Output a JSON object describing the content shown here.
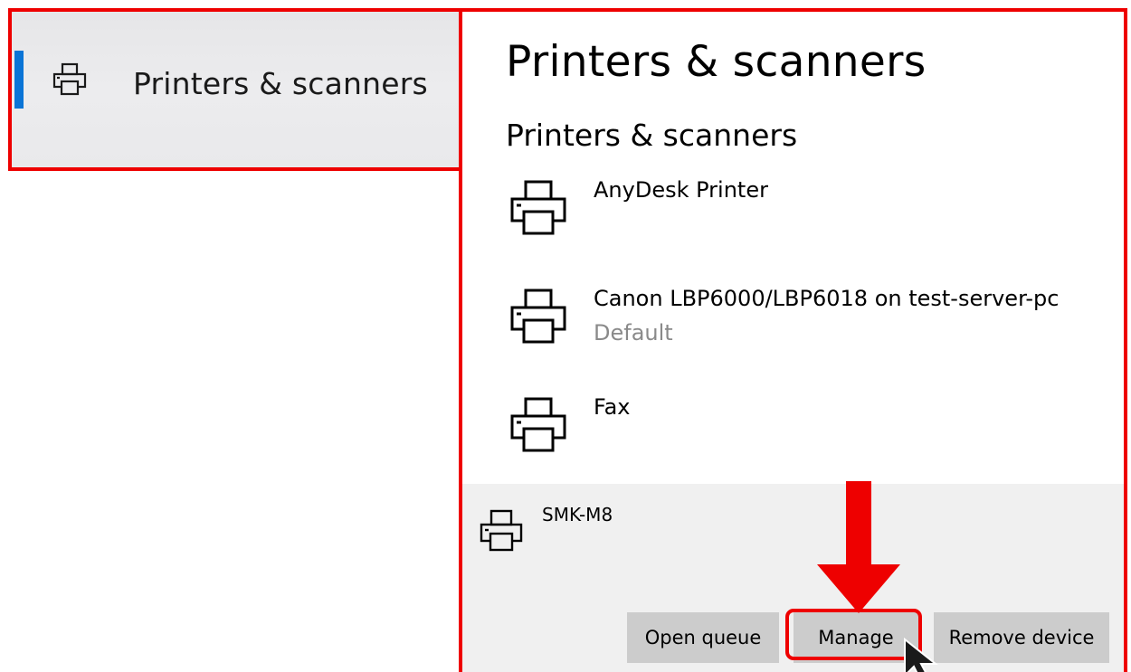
{
  "nav": {
    "label": "Printers & scanners",
    "icon": "printer-icon",
    "accent_color": "#0a74d6"
  },
  "page": {
    "title": "Printers & scanners",
    "section_title": "Printers & scanners"
  },
  "printers": [
    {
      "name": "AnyDesk Printer",
      "status": "",
      "icon": "printer-icon"
    },
    {
      "name": "Canon LBP6000/LBP6018 on test-server-pc",
      "status": "Default",
      "icon": "printer-icon"
    },
    {
      "name": "Fax",
      "status": "",
      "icon": "printer-icon"
    }
  ],
  "selected_printer": {
    "name": "SMK-M8",
    "icon": "printer-icon",
    "buttons": {
      "open_queue": "Open queue",
      "manage": "Manage",
      "remove_device": "Remove device"
    }
  },
  "annotations": {
    "highlight_color": "#ee0000",
    "arrow_icon": "down-arrow-icon",
    "cursor_icon": "mouse-cursor-icon"
  }
}
